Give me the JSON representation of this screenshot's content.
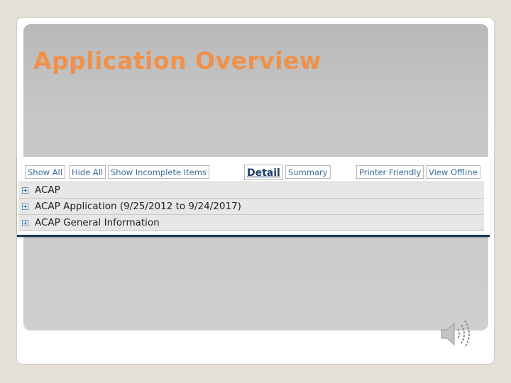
{
  "slide": {
    "title": "Application Overview"
  },
  "toolbar": {
    "buttons": [
      {
        "label": "Show All"
      },
      {
        "label": "Hide All"
      },
      {
        "label": "Show Incomplete Items"
      },
      {
        "label": "Detail"
      },
      {
        "label": "Summary"
      },
      {
        "label": "Printer Friendly"
      },
      {
        "label": "View Offline"
      }
    ]
  },
  "tree": {
    "items": [
      {
        "label": "ACAP"
      },
      {
        "label": "ACAP Application (9/25/2012 to 9/24/2017)"
      },
      {
        "label": "ACAP General Information"
      }
    ]
  },
  "icons": {
    "expand": "plus-box-icon",
    "audio": "speaker-icon"
  },
  "colors": {
    "title": "#f0914b",
    "panel": "#c7c7c7",
    "link": "#3b6c9a",
    "frame_bg": "#e6e1d8"
  }
}
